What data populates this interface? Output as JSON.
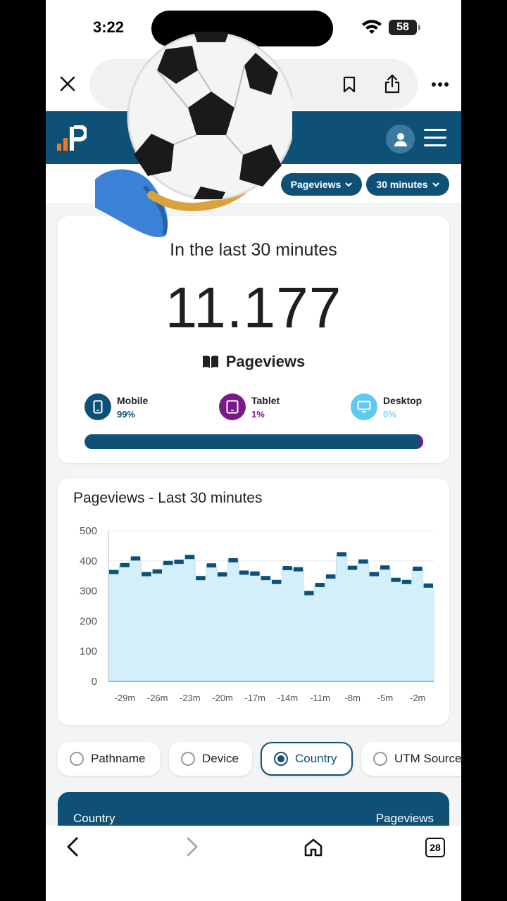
{
  "status_bar": {
    "time": "3:22",
    "battery": "58"
  },
  "browser": {
    "tab_count": "28"
  },
  "header": {
    "pageviews_button": "Pageviews",
    "range_button": "30 minutes"
  },
  "summary": {
    "title": "In the last 30 minutes",
    "value": "11.177",
    "metric": "Pageviews",
    "devices": [
      {
        "name": "Mobile",
        "pct": "99%",
        "color": "#0f5176"
      },
      {
        "name": "Tablet",
        "pct": "1%",
        "color": "#7a1a8a"
      },
      {
        "name": "Desktop",
        "pct": "0%",
        "color": "#5fc8f0"
      }
    ],
    "mobile_fraction": 0.99
  },
  "chart_title": "Pageviews - Last 30 minutes",
  "chart_data": {
    "type": "area",
    "title": "Pageviews - Last 30 minutes",
    "xlabel": "",
    "ylabel": "",
    "ylim": [
      0,
      500
    ],
    "yticks": [
      500,
      400,
      300,
      200,
      100,
      0
    ],
    "xticks": [
      "-29m",
      "-26m",
      "-23m",
      "-20m",
      "-17m",
      "-14m",
      "-11m",
      "-8m",
      "-5m",
      "-2m"
    ],
    "x": [
      -30,
      -29,
      -28,
      -27,
      -26,
      -25,
      -24,
      -23,
      -22,
      -21,
      -20,
      -19,
      -18,
      -17,
      -16,
      -15,
      -14,
      -13,
      -12,
      -11,
      -10,
      -9,
      -8,
      -7,
      -6,
      -5,
      -4,
      -3,
      -2,
      -1
    ],
    "series": [
      {
        "values": [
          363,
          386,
          408,
          356,
          365,
          393,
          397,
          413,
          343,
          385,
          355,
          402,
          361,
          358,
          343,
          330,
          376,
          372,
          293,
          320,
          348,
          422,
          377,
          398,
          356,
          378,
          337,
          330,
          374,
          318
        ]
      }
    ],
    "grid": true,
    "colors": {
      "fill": "#d3effa",
      "line": "#0f5176"
    }
  },
  "tabs": [
    {
      "label": "Pathname",
      "selected": false
    },
    {
      "label": "Device",
      "selected": false
    },
    {
      "label": "Country",
      "selected": true
    },
    {
      "label": "UTM Source",
      "selected": false
    }
  ],
  "table": {
    "col1": "Country",
    "col2": "Pageviews"
  }
}
